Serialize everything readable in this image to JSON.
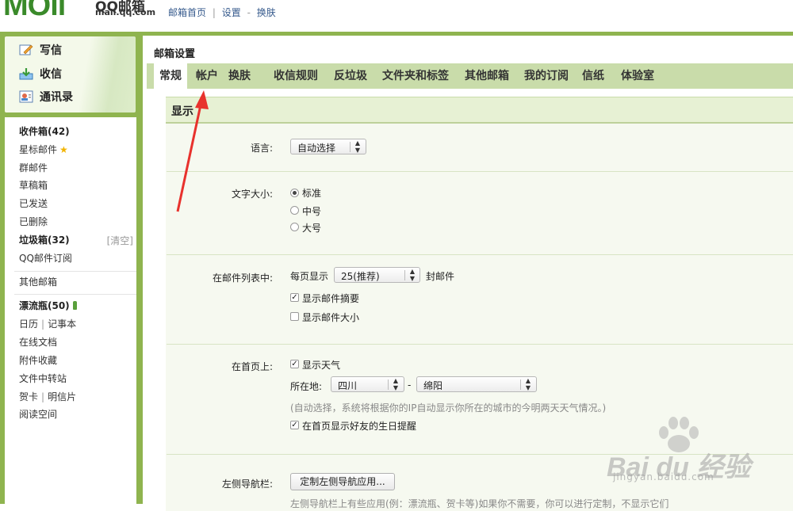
{
  "header": {
    "logo_text": "MOil",
    "logo_cn": "QQ邮箱",
    "logo_url": "mail.qq.com",
    "links": [
      "邮箱首页",
      "设置",
      "换肤"
    ],
    "link_separators": [
      "|",
      "-"
    ]
  },
  "sidebar": {
    "actions": [
      {
        "label": "写信",
        "icon": "compose-icon"
      },
      {
        "label": "收信",
        "icon": "inbox-download-icon"
      },
      {
        "label": "通讯录",
        "icon": "contacts-icon"
      }
    ],
    "folders": {
      "inbox": "收件箱(42)",
      "starred": "星标邮件",
      "group": "群邮件",
      "drafts": "草稿箱",
      "sent": "已发送",
      "deleted": "已删除",
      "spam": "垃圾箱(32)",
      "spam_clear": "[清空]",
      "subscription": "QQ邮件订阅",
      "other_mailbox": "其他邮箱",
      "drift_bottle": "漂流瓶(50)",
      "calendar": "日历",
      "notepad": "记事本",
      "online_docs": "在线文档",
      "attachments": "附件收藏",
      "file_transfer": "文件中转站",
      "greeting_card": "贺卡",
      "postcard": "明信片",
      "reading": "阅读空间"
    }
  },
  "main": {
    "title": "邮箱设置",
    "tabs": [
      "常规",
      "帐户",
      "换肤",
      "收信规则",
      "反垃圾",
      "文件夹和标签",
      "其他邮箱",
      "我的订阅",
      "信纸",
      "体验室"
    ],
    "active_tab": "常规",
    "section": "显示",
    "language": {
      "label": "语言:",
      "value": "自动选择"
    },
    "font_size": {
      "label": "文字大小:",
      "options": [
        "标准",
        "中号",
        "大号"
      ],
      "selected": "标准"
    },
    "mail_list": {
      "label": "在邮件列表中:",
      "per_page_prefix": "每页显示",
      "per_page_value": "25(推荐)",
      "per_page_suffix": "封邮件",
      "show_summary": "显示邮件摘要",
      "show_summary_checked": true,
      "show_size": "显示邮件大小",
      "show_size_checked": false
    },
    "home_page": {
      "label": "在首页上:",
      "show_weather": "显示天气",
      "show_weather_checked": true,
      "location_label": "所在地:",
      "province": "四川",
      "dash": "-",
      "city": "绵阳",
      "hint": "(自动选择，系统将根据你的IP自动显示你所在的城市的今明两天天气情况。)",
      "show_birthday": "在首页显示好友的生日提醒",
      "show_birthday_checked": true
    },
    "left_nav": {
      "label": "左侧导航栏:",
      "button": "定制左侧导航应用...",
      "hint": "左侧导航栏上有些应用(例：漂流瓶、贺卡等)如果你不需要，你可以进行定制，不显示它们"
    }
  },
  "watermark": {
    "text": "Bai du 经验",
    "url": "jingyan.baidu.com"
  },
  "colors": {
    "frame_green": "#8fb44f",
    "tab_bar": "#c9dcaa",
    "section_bar": "#e7f1d4",
    "arrow_red": "#e8322d"
  }
}
